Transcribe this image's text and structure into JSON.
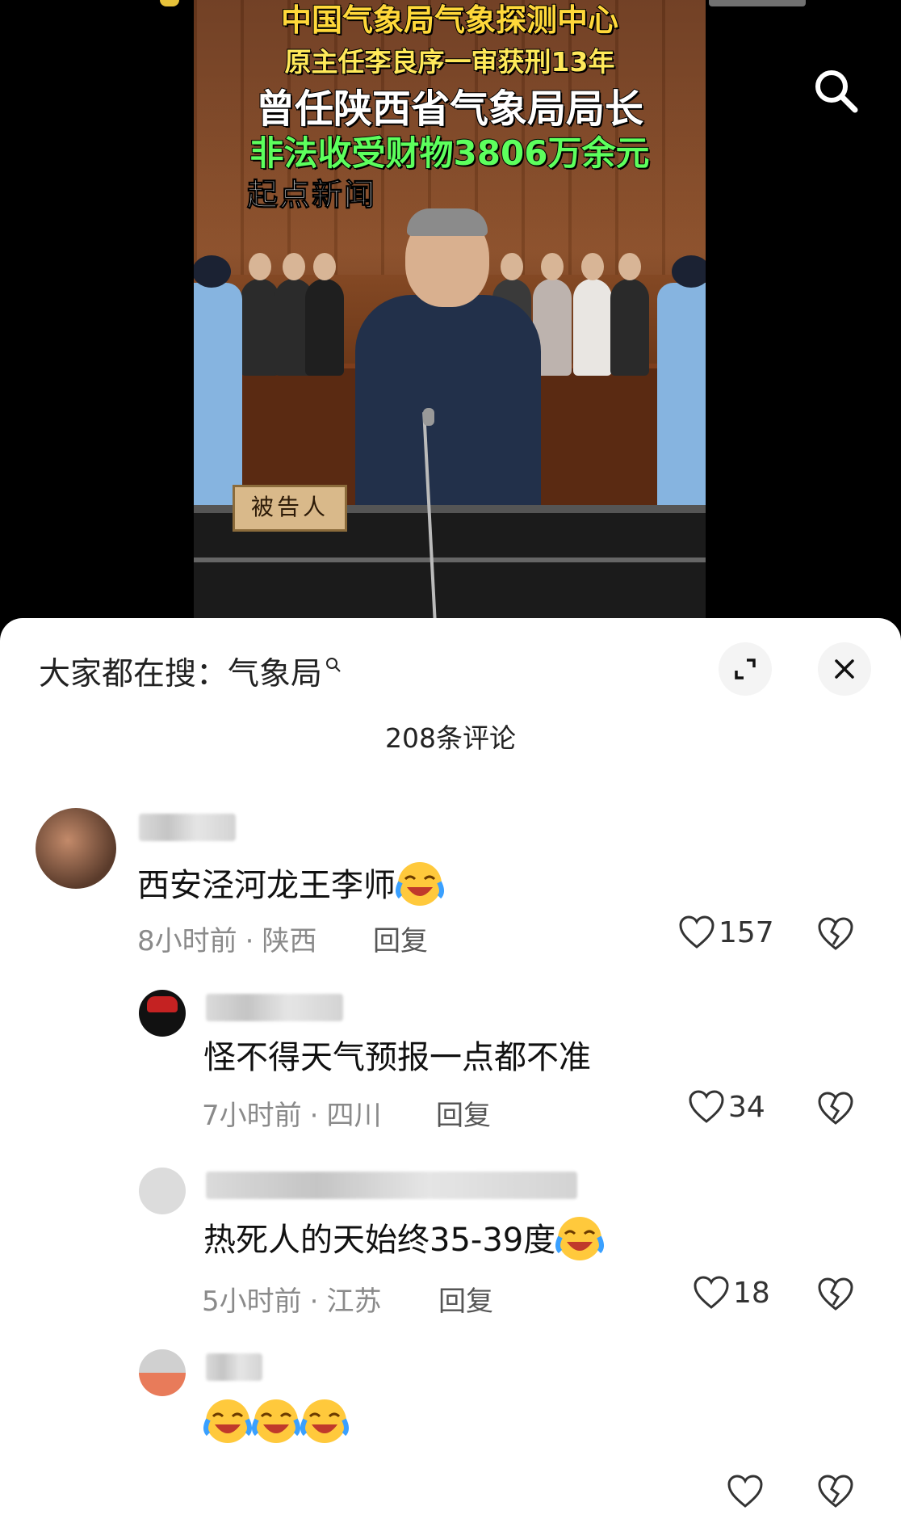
{
  "video": {
    "overlay_line1": "中国气象局气象探测中心",
    "overlay_line2": "原主任李良序一审获刑13年",
    "overlay_line3": "曾任陕西省气象局局长",
    "overlay_line4": "非法收受财物3806万余元",
    "source_logo": "起点新闻",
    "plaque_text": "被告人",
    "search_icon": "search-icon"
  },
  "sheet": {
    "hot_search_prefix": "大家都在搜：",
    "hot_search_keyword": "气象局",
    "expand_icon": "expand-icon",
    "close_icon": "close-icon",
    "comment_count": "208条评论"
  },
  "comments": [
    {
      "text": "西安泾河龙王李师",
      "emoji": "crying-laughing-emoji",
      "time": "8小时前",
      "location": "陕西",
      "reply_label": "回复",
      "likes": "157"
    },
    {
      "text": "怪不得天气预报一点都不准",
      "time": "7小时前",
      "location": "四川",
      "reply_label": "回复",
      "likes": "34"
    },
    {
      "text": "热死人的天始终35-39度",
      "emoji": "crying-laughing-emoji",
      "time": "5小时前",
      "location": "江苏",
      "reply_label": "回复",
      "likes": "18"
    },
    {
      "text": "",
      "emoji_count": 3,
      "emoji": "crying-laughing-emoji",
      "likes": ""
    }
  ],
  "colors": {
    "overlay_yellow": "#ffd83a",
    "overlay_green": "#5dff5d",
    "meta_gray": "#8a8a8a",
    "emoji_yellow": "#ffc93c",
    "emoji_blue": "#3aa0ff"
  }
}
